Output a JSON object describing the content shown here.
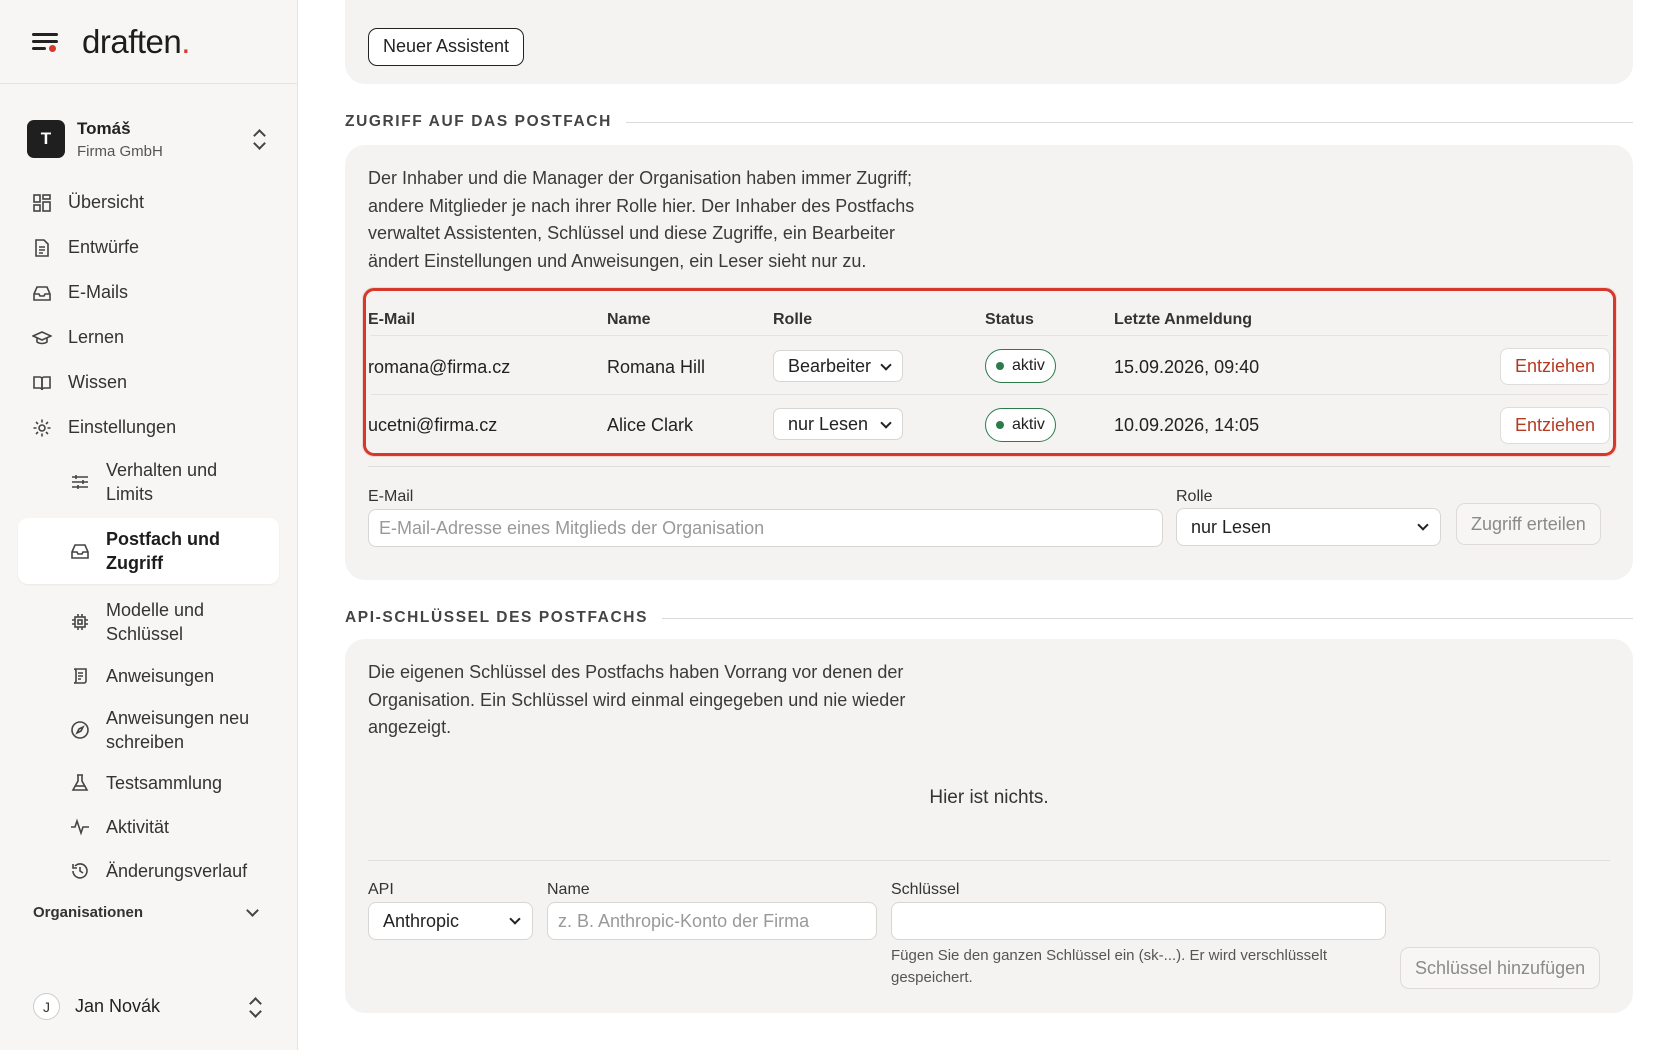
{
  "brand": {
    "logo_text": "draften",
    "logo_dot": "."
  },
  "account": {
    "initial": "T",
    "name": "Tomáš",
    "org": "Firma GmbH"
  },
  "nav": {
    "items": [
      {
        "label": "Übersicht"
      },
      {
        "label": "Entwürfe"
      },
      {
        "label": "E-Mails"
      },
      {
        "label": "Lernen"
      },
      {
        "label": "Wissen"
      },
      {
        "label": "Einstellungen"
      }
    ],
    "settings_sub": [
      {
        "label": "Verhalten und Limits"
      },
      {
        "label": "Postfach und Zugriff"
      },
      {
        "label": "Modelle und Schlüssel"
      },
      {
        "label": "Anweisungen"
      },
      {
        "label": "Anweisungen neu schreiben"
      },
      {
        "label": "Testsammlung"
      },
      {
        "label": "Aktivität"
      },
      {
        "label": "Änderungsverlauf"
      }
    ]
  },
  "organisations_label": "Organisationen",
  "user": {
    "initial": "J",
    "name": "Jan Novák"
  },
  "top": {
    "new_assistant": "Neuer Assistent"
  },
  "access": {
    "heading": "ZUGRIFF AUF DAS POSTFACH",
    "description": "Der Inhaber und die Manager der Organisation haben immer Zugriff; andere Mitglieder je nach ihrer Rolle hier. Der Inhaber des Postfachs verwaltet Assistenten, Schlüssel und diese Zugriffe, ein Bearbeiter ändert Einstellungen und Anweisungen, ein Leser sieht nur zu.",
    "columns": [
      "E-Mail",
      "Name",
      "Rolle",
      "Status",
      "Letzte Anmeldung"
    ],
    "rows": [
      {
        "email": "romana@firma.cz",
        "name": "Romana Hill",
        "role": "Bearbeiter",
        "status": "aktiv",
        "last_login": "15.09.2026, 09:40",
        "action": "Entziehen"
      },
      {
        "email": "ucetni@firma.cz",
        "name": "Alice Clark",
        "role": "nur Lesen",
        "status": "aktiv",
        "last_login": "10.09.2026, 14:05",
        "action": "Entziehen"
      }
    ],
    "form": {
      "email_label": "E-Mail",
      "email_placeholder": "E-Mail-Adresse eines Mitglieds der Organisation",
      "role_label": "Rolle",
      "role_value": "nur Lesen",
      "submit": "Zugriff erteilen"
    }
  },
  "api": {
    "heading": "API-SCHLÜSSEL DES POSTFACHS",
    "description": "Die eigenen Schlüssel des Postfachs haben Vorrang vor denen der Organisation. Ein Schlüssel wird einmal eingegeben und nie wieder angezeigt.",
    "empty": "Hier ist nichts.",
    "form": {
      "api_label": "API",
      "api_value": "Anthropic",
      "name_label": "Name",
      "name_placeholder": "z. B. Anthropic-Konto der Firma",
      "key_label": "Schlüssel",
      "key_hint": "Fügen Sie den ganzen Schlüssel ein (sk-...). Er wird verschlüsselt gespeichert.",
      "submit": "Schlüssel hinzufügen"
    }
  },
  "colors": {
    "accent_red": "#d23a2a",
    "highlight_border": "#d6392b",
    "status_green": "#2d7a4a",
    "revoke_text": "#b53a22"
  }
}
